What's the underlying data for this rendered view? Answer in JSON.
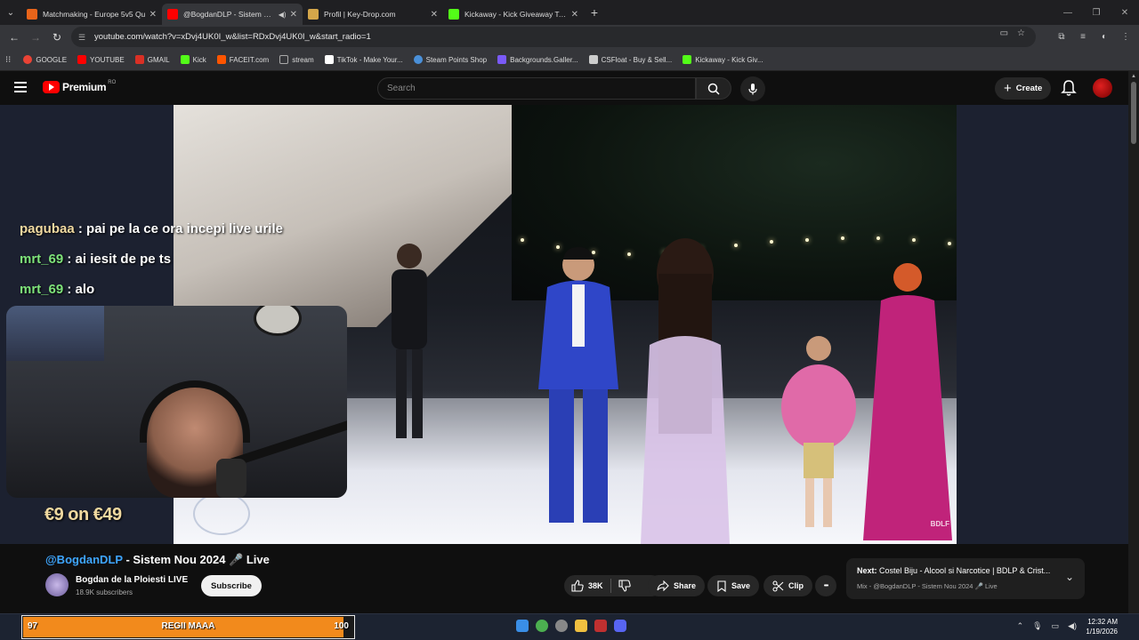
{
  "browser": {
    "tabs": [
      {
        "title": "Matchmaking - Europe 5v5 Qu",
        "favicon_color": "#e8641a",
        "active": false
      },
      {
        "title": "@BogdanDLP - Sistem Nou",
        "favicon_color": "#ff0000",
        "active": true
      },
      {
        "title": "Profil | Key-Drop.com",
        "favicon_color": "#d4a64a",
        "active": false
      },
      {
        "title": "Kickaway - Kick Giveaway Tool",
        "favicon_color": "#53fc18",
        "active": false
      }
    ],
    "url": "youtube.com/watch?v=xDvj4UK0I_w&list=RDxDvj4UK0I_w&start_radio=1",
    "bookmarks": [
      {
        "label": "GOOGLE",
        "icon": "google-icon",
        "color": "#ea4335"
      },
      {
        "label": "YOUTUBE",
        "icon": "youtube-icon",
        "color": "#ff0000"
      },
      {
        "label": "GMAIL",
        "icon": "gmail-icon",
        "color": "#d93025"
      },
      {
        "label": "Kick",
        "icon": "kick-icon",
        "color": "#53fc18"
      },
      {
        "label": "FACEIT.com",
        "icon": "faceit-icon",
        "color": "#ff5500"
      },
      {
        "label": "stream",
        "icon": "folder-icon",
        "color": "#888888"
      },
      {
        "label": "TikTok - Make Your...",
        "icon": "tiktok-icon",
        "color": "#ffffff"
      },
      {
        "label": "Steam Points Shop",
        "icon": "steam-icon",
        "color": "#4a90d9"
      },
      {
        "label": "Backgrounds.Galler...",
        "icon": "gallery-icon",
        "color": "#7a5af8"
      },
      {
        "label": "CSFloat - Buy & Sell...",
        "icon": "csfloat-icon",
        "color": "#cccccc"
      },
      {
        "label": "Kickaway - Kick Giv...",
        "icon": "kick-icon",
        "color": "#53fc18"
      }
    ]
  },
  "youtube": {
    "logo_text": "Premium",
    "region": "RO",
    "search_placeholder": "Search",
    "create_label": "Create"
  },
  "overlay": {
    "chat": [
      {
        "user": "pagubaa",
        "sep": " : ",
        "message": "pai pe la ce ora incepi live urile"
      },
      {
        "user": "mrt_69",
        "sep": " : ",
        "message": "ai iesit de pe ts"
      },
      {
        "user": "mrt_69",
        "sep": " : ",
        "message": "alo"
      }
    ],
    "goal_text": "€9 on €49",
    "video_corner": "BDLF"
  },
  "video": {
    "title_channel": "@BogdanDLP",
    "title_rest": " - Sistem Nou 2024 🎤 Live",
    "channel_name": "Bogdan de la Ploiesti LIVE",
    "subscribers": "18.9K subscribers",
    "subscribe_label": "Subscribe",
    "likes": "38K",
    "share_label": "Share",
    "save_label": "Save",
    "clip_label": "Clip",
    "more_label": "•••",
    "next_prefix": "Next:",
    "next_title": "Costel Biju - Alcool si Narcotice | BDLP & Crist...",
    "next_sub": "Mix - @BogdanDLP - Sistem Nou 2024 🎤 Live"
  },
  "taskbar": {
    "goal_start": "97",
    "goal_label": "REGII MAAA",
    "goal_end": "100",
    "goal_fraction": 0.97,
    "time": "12:32 AM",
    "date": "1/19/2026"
  }
}
